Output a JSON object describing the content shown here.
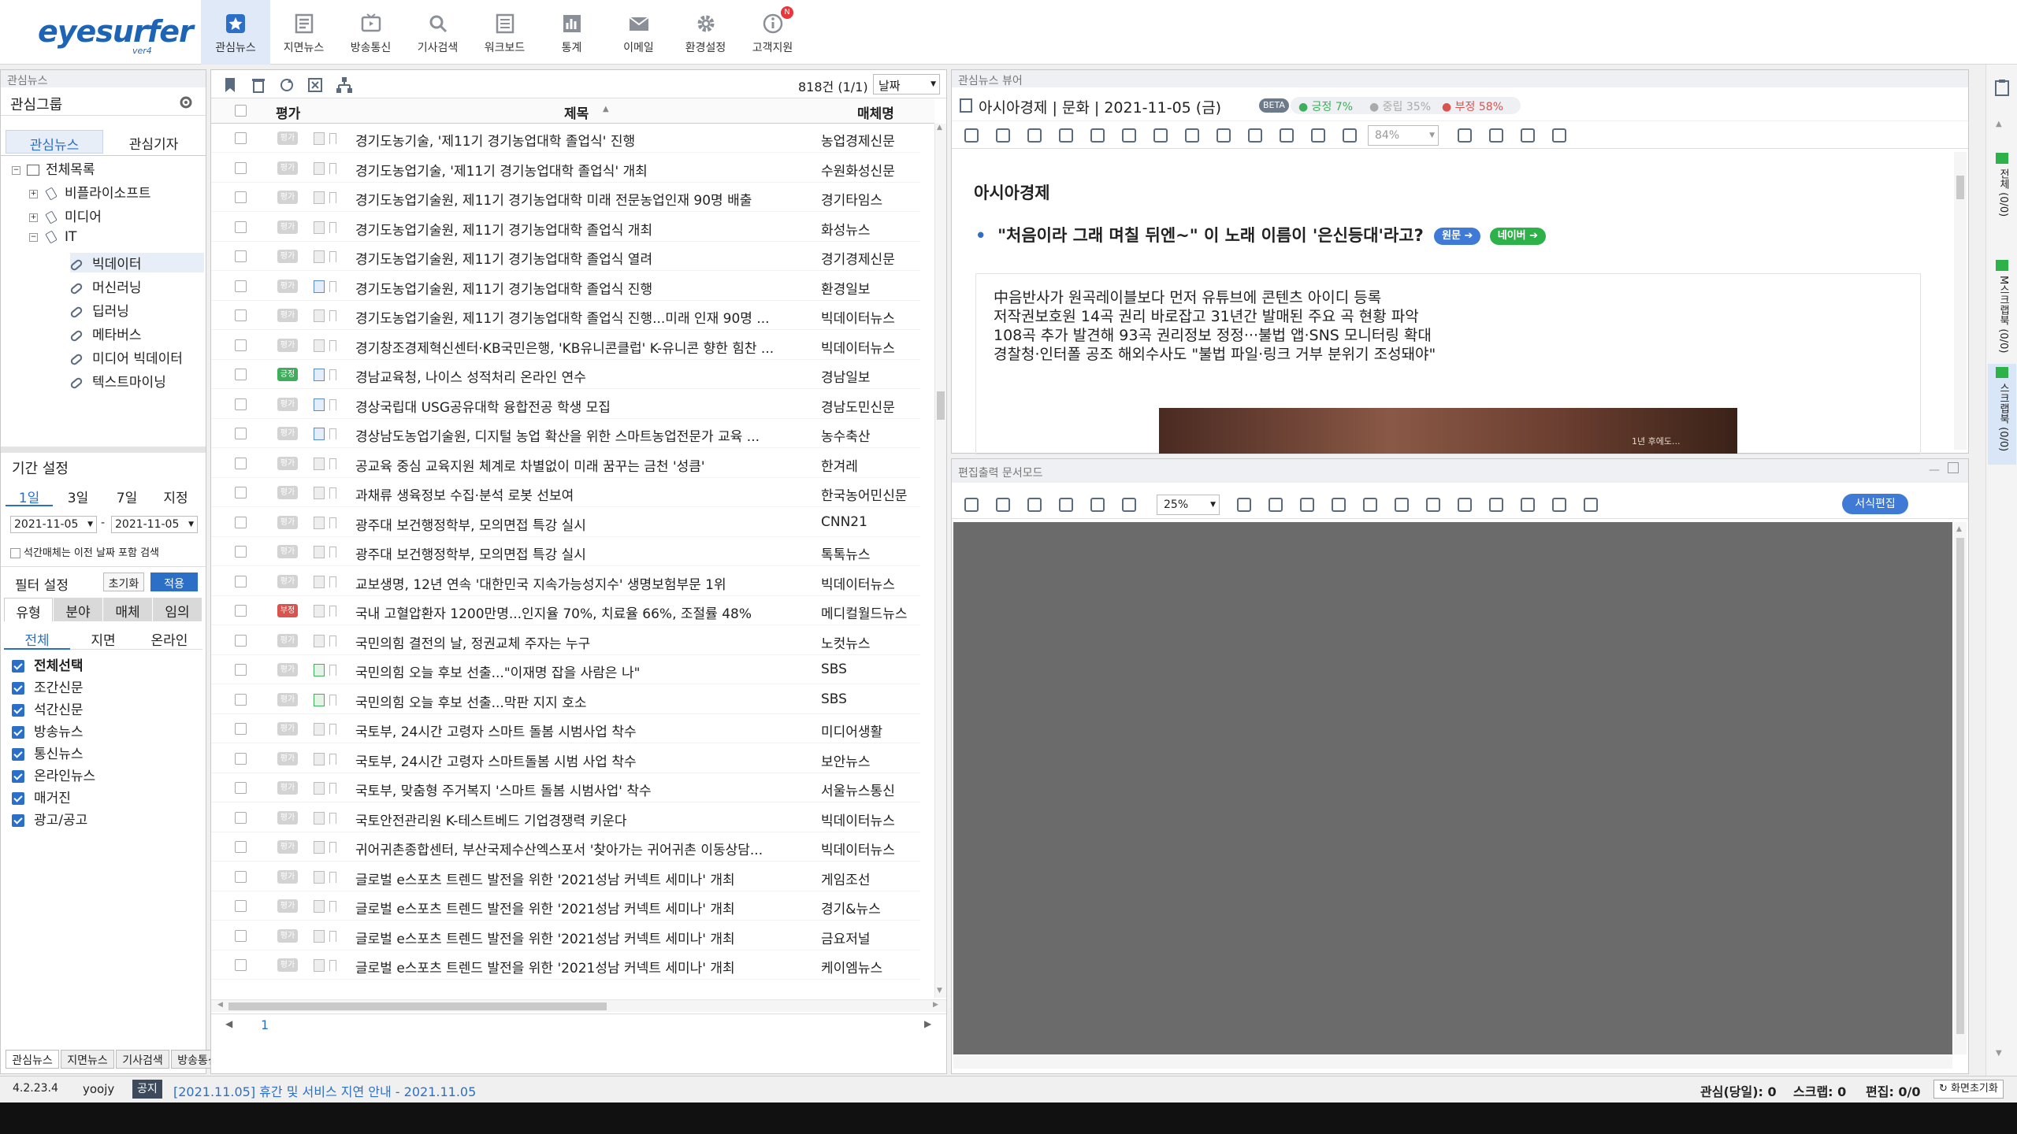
{
  "app": {
    "logo": "eyesurfer",
    "logo_ver": "ver4"
  },
  "nav": [
    {
      "label": "관심뉴스",
      "icon": "star-icon"
    },
    {
      "label": "지면뉴스",
      "icon": "newspaper-icon"
    },
    {
      "label": "방송통신",
      "icon": "tv-icon"
    },
    {
      "label": "기사검색",
      "icon": "search-icon"
    },
    {
      "label": "워크보드",
      "icon": "board-icon"
    },
    {
      "label": "통계",
      "icon": "chart-icon"
    },
    {
      "label": "이메일",
      "icon": "mail-icon"
    },
    {
      "label": "환경설정",
      "icon": "gear-icon"
    },
    {
      "label": "고객지원",
      "icon": "info-icon",
      "badge": "N"
    }
  ],
  "left": {
    "panel_title": "관심뉴스",
    "group_label": "관심그룹",
    "tabs": [
      "관심뉴스",
      "관심기자"
    ],
    "tree": [
      {
        "label": "전체목록",
        "level": 0
      },
      {
        "label": "비플라이소프트",
        "level": 1
      },
      {
        "label": "미디어",
        "level": 1
      },
      {
        "label": "IT",
        "level": 1
      },
      {
        "label": "빅데이터",
        "level": 2
      },
      {
        "label": "머신러닝",
        "level": 2
      },
      {
        "label": "딥러닝",
        "level": 2
      },
      {
        "label": "메타버스",
        "level": 2
      },
      {
        "label": "미디어 빅데이터",
        "level": 2
      },
      {
        "label": "텍스트마이닝",
        "level": 2
      }
    ],
    "period_label": "기간 설정",
    "period_tabs": [
      "1일",
      "3일",
      "7일",
      "지정"
    ],
    "date_from": "2021-11-05",
    "date_to": "2021-11-05",
    "date_sep": "-",
    "evening_option": "석간매체는 이전 날짜 포함 검색",
    "filter_label": "필터 설정",
    "reset_label": "초기화",
    "apply_label": "적용",
    "filter_tabs": [
      "유형",
      "분야",
      "매체",
      "임의"
    ],
    "type_tabs": [
      "전체",
      "지면",
      "온라인"
    ],
    "checks": [
      "전체선택",
      "조간신문",
      "석간신문",
      "방송뉴스",
      "통신뉴스",
      "온라인뉴스",
      "매거진",
      "광고/공고"
    ],
    "bottom_tabs": [
      "관심뉴스",
      "지면뉴스",
      "기사검색",
      "방송통신"
    ]
  },
  "list": {
    "count": "818건 (1/1)",
    "sort": "날짜",
    "col_eval": "평가",
    "col_title": "제목",
    "col_media": "매체명",
    "page": "1",
    "rows": [
      {
        "title": "경기도농기술, '제11기 경기농업대학 졸업식' 진행",
        "media": "농업경제신문",
        "ev": "",
        "doc": "n"
      },
      {
        "title": "경기도농업기술, '제11기 경기농업대학 졸업식' 개최",
        "media": "수원화성신문",
        "ev": "",
        "doc": "n"
      },
      {
        "title": "경기도농업기술원, 제11기 경기농업대학 미래 전문농업인재 90명 배출",
        "media": "경기타임스",
        "ev": "",
        "doc": "n"
      },
      {
        "title": "경기도농업기술원, 제11기 경기농업대학 졸업식 개최",
        "media": "화성뉴스",
        "ev": "",
        "doc": "n"
      },
      {
        "title": "경기도농업기술원, 제11기 경기농업대학 졸업식 열려",
        "media": "경기경제신문",
        "ev": "",
        "doc": "n"
      },
      {
        "title": "경기도농업기술원, 제11기 경기농업대학 졸업식 진행",
        "media": "환경일보",
        "ev": "",
        "doc": "b"
      },
      {
        "title": "경기도농업기술원, 제11기 경기농업대학 졸업식 진행...미래 인재 90명 ...",
        "media": "빅데이터뉴스",
        "ev": "",
        "doc": "n"
      },
      {
        "title": "경기창조경제혁신센터·KB국민은행, 'KB유니콘클럽' K-유니콘 향한 힘찬 ...",
        "media": "빅데이터뉴스",
        "ev": "",
        "doc": "n"
      },
      {
        "title": "경남교육청, 나이스 성적처리 온라인 연수",
        "media": "경남일보",
        "ev": "긍정",
        "doc": "b"
      },
      {
        "title": "경상국립대 USG공유대학 융합전공 학생 모집",
        "media": "경남도민신문",
        "ev": "",
        "doc": "b"
      },
      {
        "title": "경상남도농업기술원, 디지털 농업 확산을 위한 스마트농업전문가 교육 ...",
        "media": "농수축산",
        "ev": "",
        "doc": "b"
      },
      {
        "title": "공교육 중심 교육지원 체계로 차별없이 미래 꿈꾸는 금천 '성큼'",
        "media": "한겨레",
        "ev": "",
        "doc": "n"
      },
      {
        "title": "과채류 생육정보 수집·분석 로봇 선보여",
        "media": "한국농어민신문",
        "ev": "",
        "doc": "n"
      },
      {
        "title": "광주대 보건행정학부, 모의면접 특강 실시",
        "media": "CNN21",
        "ev": "",
        "doc": "n"
      },
      {
        "title": "광주대 보건행정학부, 모의면접 특강 실시",
        "media": "톡톡뉴스",
        "ev": "",
        "doc": "n"
      },
      {
        "title": "교보생명, 12년 연속 '대한민국 지속가능성지수' 생명보험부문 1위",
        "media": "빅데이터뉴스",
        "ev": "",
        "doc": "n"
      },
      {
        "title": "국내 고혈압환자 1200만명...인지율 70%, 치료율 66%, 조절률 48%",
        "media": "메디컬월드뉴스",
        "ev": "부정",
        "doc": "n"
      },
      {
        "title": "국민의힘 결전의 날, 정권교체 주자는 누구",
        "media": "노컷뉴스",
        "ev": "",
        "doc": "n"
      },
      {
        "title": "국민의힘 오늘 후보 선출...\"이재명 잡을 사람은 나\"",
        "media": "SBS",
        "ev": "",
        "doc": "g"
      },
      {
        "title": "국민의힘 오늘 후보 선출...막판 지지 호소",
        "media": "SBS",
        "ev": "",
        "doc": "g"
      },
      {
        "title": "국토부, 24시간 고령자 스마트 돌봄 시범사업 착수",
        "media": "미디어생활",
        "ev": "",
        "doc": "n"
      },
      {
        "title": "국토부, 24시간 고령자 스마트돌봄 시범 사업 착수",
        "media": "보안뉴스",
        "ev": "",
        "doc": "n"
      },
      {
        "title": "국토부, 맞춤형 주거복지 '스마트 돌봄 시범사업' 착수",
        "media": "서울뉴스통신",
        "ev": "",
        "doc": "n"
      },
      {
        "title": "국토안전관리원 K-테스트베드 기업경쟁력 키운다",
        "media": "빅데이터뉴스",
        "ev": "",
        "doc": "n"
      },
      {
        "title": "귀어귀촌종합센터, 부산국제수산엑스포서 '찾아가는 귀어귀촌 이동상담...",
        "media": "빅데이터뉴스",
        "ev": "",
        "doc": "n"
      },
      {
        "title": "글로벌 e스포츠 트렌드 발전을 위한 '2021성남 커넥트 세미나' 개최",
        "media": "게임조선",
        "ev": "",
        "doc": "n"
      },
      {
        "title": "글로벌 e스포츠 트렌드 발전을 위한 '2021성남 커넥트 세미나' 개최",
        "media": "경기&뉴스",
        "ev": "",
        "doc": "n"
      },
      {
        "title": "글로벌 e스포츠 트렌드 발전을 위한 '2021성남 커넥트 세미나' 개최",
        "media": "금요저널",
        "ev": "",
        "doc": "n"
      },
      {
        "title": "글로벌 e스포츠 트렌드 발전을 위한 '2021성남 커넥트 세미나' 개최",
        "media": "케이엠뉴스",
        "ev": "",
        "doc": "n"
      }
    ]
  },
  "viewer": {
    "panel_title": "관심뉴스 뷰어",
    "header": "아시아경제 | 문화 | 2021-11-05 (금)",
    "beta": "BETA",
    "pos": "긍정 7%",
    "neu": "중립 35%",
    "neg": "부정 58%",
    "zoom": "84%",
    "source": "아시아경제",
    "headline": "\"처음이라 그래 며칠 뒤엔~\" 이 노래 이름이 '은신등대'라고?",
    "btn_orig": "원문",
    "btn_naver": "네이버",
    "summary": [
      "中음반사가 원곡레이블보다 먼저 유튜브에 콘텐츠 아이디 등록",
      "저작권보호원 14곡 권리 바로잡고 31년간 발매된 주요 곡 현황 파악",
      "108곡 추가 발견해 93곡 권리정보 정정···불법 앱·SNS 모니터링 확대",
      "경찰청·인터폴 공조 해외수사도 \"불법 파일·링크 거부 분위기 조성돼야\""
    ],
    "image_caption": "1년 후에도..."
  },
  "editor": {
    "panel_title": "편집출력 문서모드",
    "zoom": "25%",
    "format_btn": "서식편집"
  },
  "rightbar": {
    "items": [
      "전체 (0/0)",
      "M스크랩북 (0/0)",
      "스크랩북 (0/0)"
    ]
  },
  "status": {
    "version": "4.2.23.4",
    "user": "yoojy",
    "notice_tag": "공지",
    "notice": "[2021.11.05] 휴간 및 서비스 지연 안내 - 2021.11.05",
    "interest": "관심(당일): 0",
    "scrap": "스크랩: 0",
    "edit": "편집: 0/0",
    "reset": "화면초기화"
  },
  "colors": {
    "accent": "#2c6fc7",
    "positive": "#3fae5c",
    "negative": "#d9534f",
    "neutral": "#9e9e9e"
  }
}
